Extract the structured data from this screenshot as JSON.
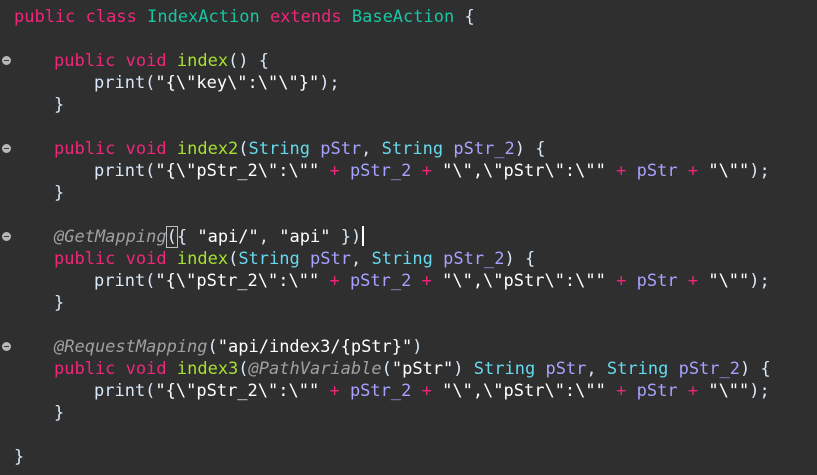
{
  "editor": {
    "line1": {
      "t1": "public",
      "t2": "class",
      "t3": "IndexAction",
      "t4": "extends",
      "t5": "BaseAction",
      "t6": "{"
    },
    "line3": {
      "t1": "public",
      "t2": "void",
      "t3": "index",
      "t4": "() {"
    },
    "line4": {
      "t1": "print(",
      "t2": "\"{\\\"key\\\":\\\"\\\"}\"",
      "t3": ");"
    },
    "line5": {
      "t1": "}"
    },
    "line7": {
      "t1": "public",
      "t2": "void",
      "t3": "index2",
      "t4": "(",
      "t5": "String",
      "t6": "pStr",
      "t7": ",",
      "t8": "String",
      "t9": "pStr_2",
      "t10": ") {"
    },
    "line8": {
      "t1": "print(",
      "t2": "\"{\\\"pStr_2\\\":\\\"\"",
      "t3": "+",
      "t4": "pStr_2",
      "t5": "+",
      "t6": "\"\\\",\\\"pStr\\\":\\\"\"",
      "t7": "+",
      "t8": "pStr",
      "t9": "+",
      "t10": "\"\\\"\"",
      "t11": ");"
    },
    "line9": {
      "t1": "}"
    },
    "line11": {
      "t1": "@GetMapping",
      "t2": "(",
      "t3": "{",
      "t4": "\"api/\"",
      "t5": ",",
      "t6": "\"api\"",
      "t7": "})"
    },
    "line12": {
      "t1": "public",
      "t2": "void",
      "t3": "index",
      "t4": "(",
      "t5": "String",
      "t6": "pStr",
      "t7": ",",
      "t8": "String",
      "t9": "pStr_2",
      "t10": ") {"
    },
    "line13": {
      "t1": "print(",
      "t2": "\"{\\\"pStr_2\\\":\\\"\"",
      "t3": "+",
      "t4": "pStr_2",
      "t5": "+",
      "t6": "\"\\\",\\\"pStr\\\":\\\"\"",
      "t7": "+",
      "t8": "pStr",
      "t9": "+",
      "t10": "\"\\\"\"",
      "t11": ");"
    },
    "line14": {
      "t1": "}"
    },
    "line16": {
      "t1": "@RequestMapping",
      "t2": "(",
      "t3": "\"api/index3/{pStr}\"",
      "t4": ")"
    },
    "line17": {
      "t1": "public",
      "t2": "void",
      "t3": "index3",
      "t4": "(",
      "t5": "@PathVariable",
      "t6": "(",
      "t7": "\"pStr\"",
      "t8": ")",
      "t9": "String",
      "t10": "pStr",
      "t11": ",",
      "t12": "String",
      "t13": "pStr_2",
      "t14": ") {"
    },
    "line18": {
      "t1": "print(",
      "t2": "\"{\\\"pStr_2\\\":\\\"\"",
      "t3": "+",
      "t4": "pStr_2",
      "t5": "+",
      "t6": "\"\\\",\\\"pStr\\\":\\\"\"",
      "t7": "+",
      "t8": "pStr",
      "t9": "+",
      "t10": "\"\\\"\"",
      "t11": ");"
    },
    "line19": {
      "t1": "}"
    },
    "line21": {
      "t1": "}"
    }
  }
}
